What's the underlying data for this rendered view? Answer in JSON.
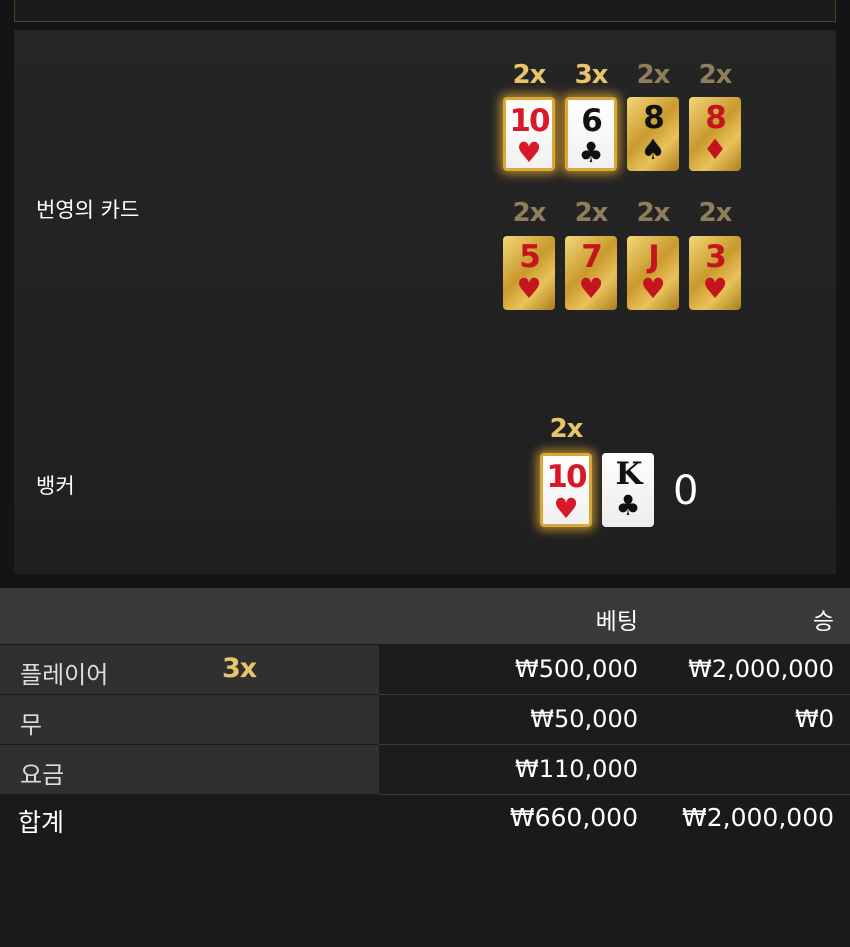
{
  "board": {
    "prosperity_label": "번영의 카드",
    "prosperity_cards": [
      {
        "multiplier": "2x",
        "rank": "10",
        "suit": "♥",
        "color": "red",
        "style": "white-gold",
        "mult_style": "bright"
      },
      {
        "multiplier": "3x",
        "rank": "6",
        "suit": "♣",
        "color": "black",
        "style": "white-gold",
        "mult_style": "bright"
      },
      {
        "multiplier": "2x",
        "rank": "8",
        "suit": "♠",
        "color": "black",
        "style": "gold",
        "mult_style": "dim"
      },
      {
        "multiplier": "2x",
        "rank": "8",
        "suit": "♦",
        "color": "red",
        "style": "gold",
        "mult_style": "dim"
      },
      {
        "multiplier": "2x",
        "rank": "5",
        "suit": "♥",
        "color": "red",
        "style": "gold",
        "mult_style": "dim"
      },
      {
        "multiplier": "2x",
        "rank": "7",
        "suit": "♥",
        "color": "red",
        "style": "gold",
        "mult_style": "dim"
      },
      {
        "multiplier": "2x",
        "rank": "J",
        "suit": "♥",
        "color": "red",
        "style": "gold",
        "mult_style": "dim"
      },
      {
        "multiplier": "2x",
        "rank": "3",
        "suit": "♥",
        "color": "red",
        "style": "gold",
        "mult_style": "dim"
      }
    ],
    "banker_label": "뱅커",
    "banker_multiplier": "2x",
    "banker_cards": [
      {
        "rank": "10",
        "suit": "♥",
        "color": "red",
        "style": "white-gold"
      },
      {
        "rank": "K",
        "suit": "♣",
        "color": "black",
        "style": "white"
      }
    ],
    "banker_score": "0"
  },
  "table": {
    "header": {
      "bet": "베팅",
      "win": "승"
    },
    "rows": [
      {
        "label": "플레이어",
        "badge": "3x",
        "bet": "₩500,000",
        "win": "₩2,000,000"
      },
      {
        "label": "무",
        "badge": "",
        "bet": "₩50,000",
        "win": "₩0"
      },
      {
        "label": "요금",
        "badge": "",
        "bet": "₩110,000",
        "win": ""
      }
    ],
    "total": {
      "label": "합계",
      "bet": "₩660,000",
      "win": "₩2,000,000"
    }
  },
  "colors": {
    "gold_text": "#e8c46a",
    "dim_gold_text": "#8f7e5a",
    "card_red": "#d8192a",
    "background": "#1a1a1a"
  }
}
